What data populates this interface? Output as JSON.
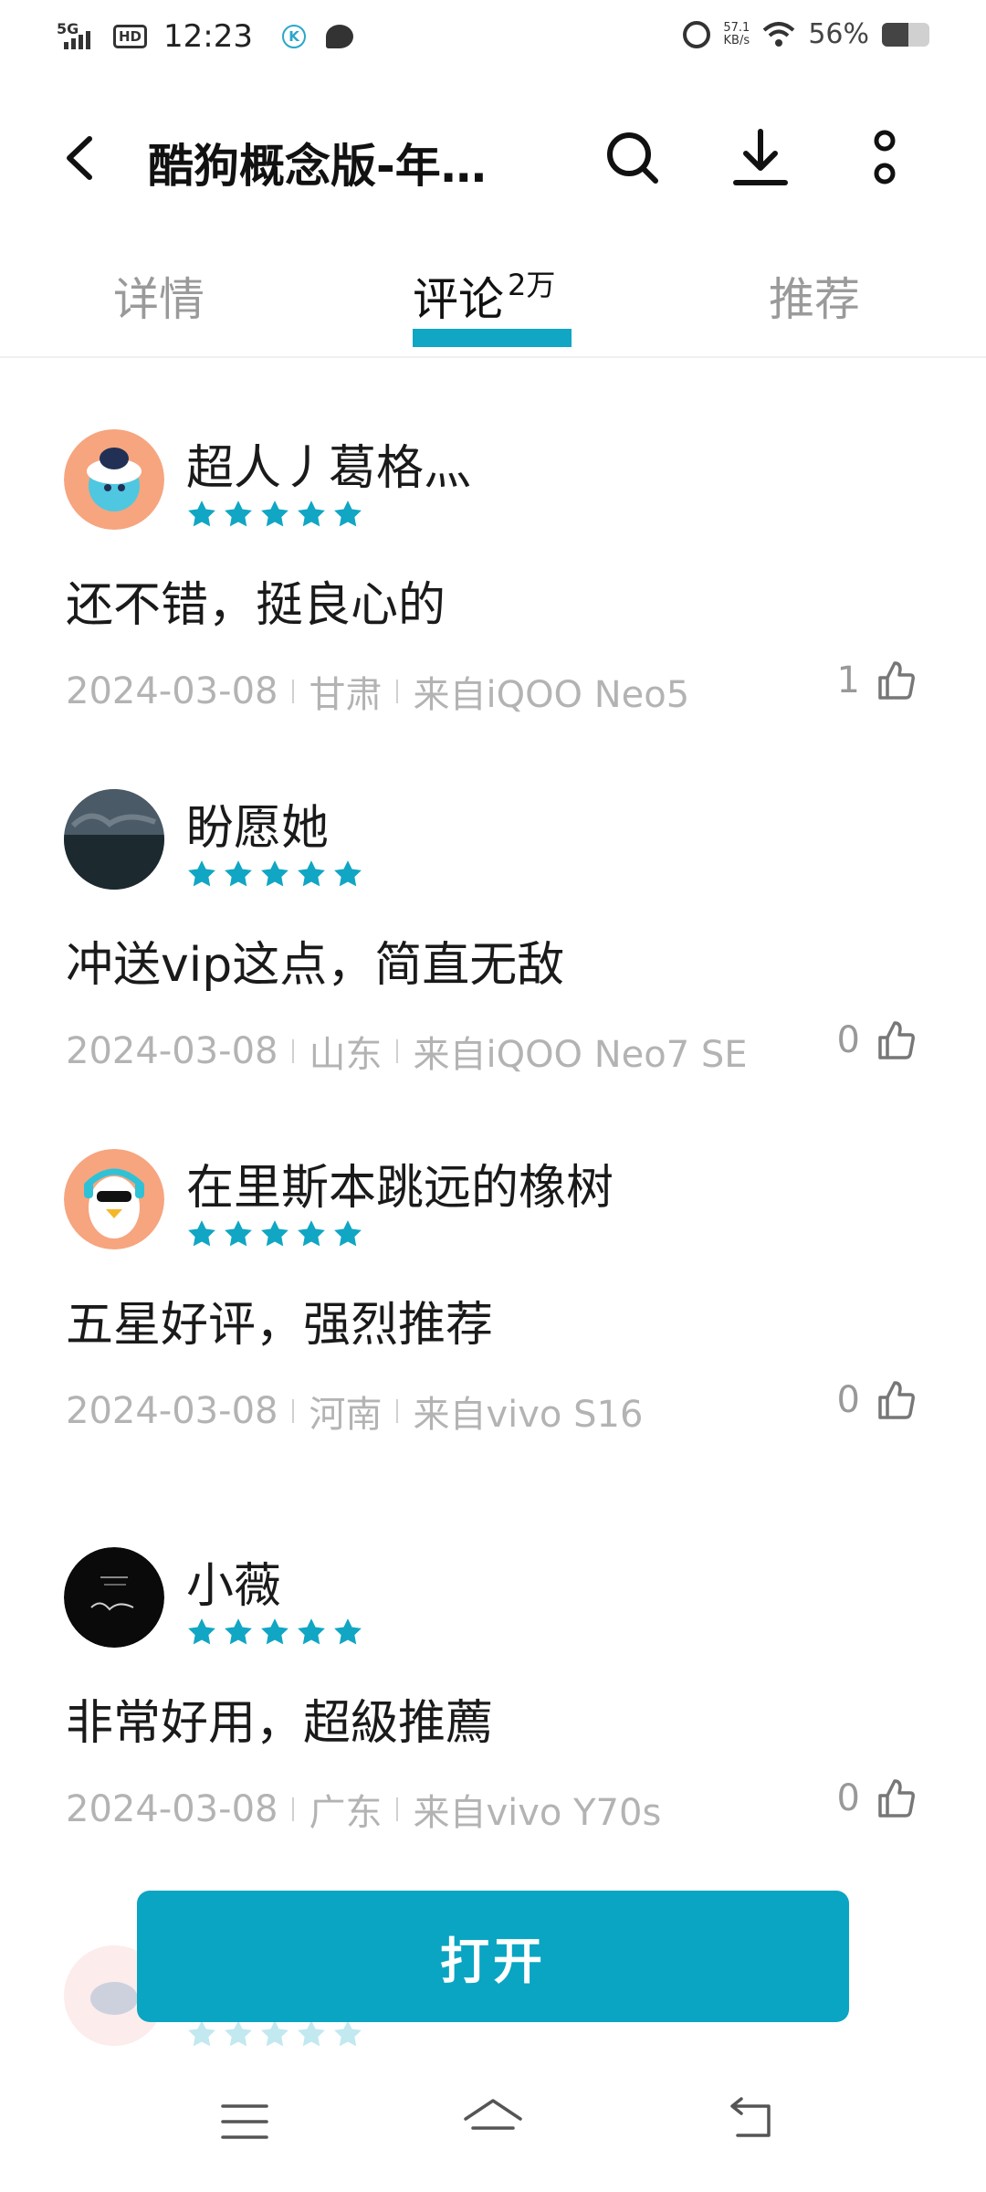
{
  "status_bar": {
    "network": "5G",
    "hd": "HD",
    "time": "12:23",
    "app_badge": "K",
    "speed_value": "57.1",
    "speed_unit": "KB/s",
    "battery_percent": "56%",
    "battery_level": 0.56
  },
  "app_bar": {
    "title": "酷狗概念版-年…",
    "icons": [
      "back-icon",
      "search-icon",
      "download-icon",
      "more-icon"
    ]
  },
  "tabs": [
    {
      "label": "详情"
    },
    {
      "label": "评论",
      "count": "2万",
      "active": true
    },
    {
      "label": "推荐"
    }
  ],
  "reviews": [
    {
      "user": "超人丿葛格灬",
      "rating": 5,
      "content": "还不错，挺良心的",
      "date": "2024-03-08",
      "region": "甘肃",
      "device": "来自iQOO Neo5",
      "likes": "1"
    },
    {
      "user": "盼愿她",
      "rating": 5,
      "content": "冲送vip这点，简直无敌",
      "date": "2024-03-08",
      "region": "山东",
      "device": "来自iQOO Neo7 SE",
      "likes": "0"
    },
    {
      "user": "在里斯本跳远的橡树",
      "rating": 5,
      "content": "五星好评，强烈推荐",
      "date": "2024-03-08",
      "region": "河南",
      "device": "来自vivo S16",
      "likes": "0"
    },
    {
      "user": "小薇",
      "rating": 5,
      "content": "非常好用，超級推薦",
      "date": "2024-03-08",
      "region": "广东",
      "device": "来自vivo Y70s",
      "likes": "0"
    }
  ],
  "open_button": {
    "label": "打开"
  },
  "colors": {
    "accent": "#0aa5c2",
    "star": "#10a6c4",
    "meta_text": "#b3b3b3"
  },
  "nav_bar": {
    "icons": [
      "menu-icon",
      "home-icon",
      "back-nav-icon"
    ]
  }
}
